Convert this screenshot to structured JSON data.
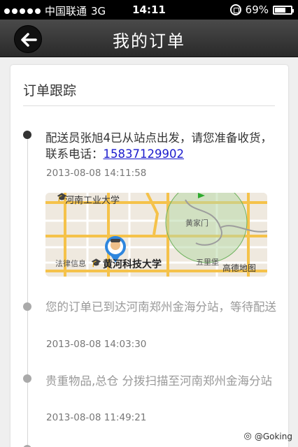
{
  "status_bar": {
    "carrier": "中国联通",
    "network": "3G",
    "time": "14:11",
    "battery": "69%",
    "battery_fraction": 0.69
  },
  "nav": {
    "title": "我的订单",
    "back_icon": "back-arrow-icon"
  },
  "section": {
    "heading": "订单跟踪"
  },
  "events": [
    {
      "text": "配送员张旭4已从站点出发，请您准备收货，联系电话：",
      "phone": "15837129902",
      "time": "2013-08-08 14:11:58"
    },
    {
      "text": "您的订单已到达河南郑州金海分站，等待配送",
      "time": "2013-08-08 14:03:30"
    },
    {
      "text": "贵重物品,总仓 分拨扫描至河南郑州金海分站",
      "time": "2013-08-08 11:49:21"
    }
  ],
  "map": {
    "labels": {
      "north_school": "河南工业大学",
      "east_area": "黄家门",
      "west_poi": "法律信息",
      "main_school": "黄河科技大学",
      "south_area": "五里堡",
      "brand": "高德地图"
    },
    "colors": {
      "road_major": "#f5c24a",
      "road_minor": "#ffffff",
      "range_fill": "#b8d9a8",
      "pin": "#2e86de"
    }
  },
  "watermark": "@Goking"
}
